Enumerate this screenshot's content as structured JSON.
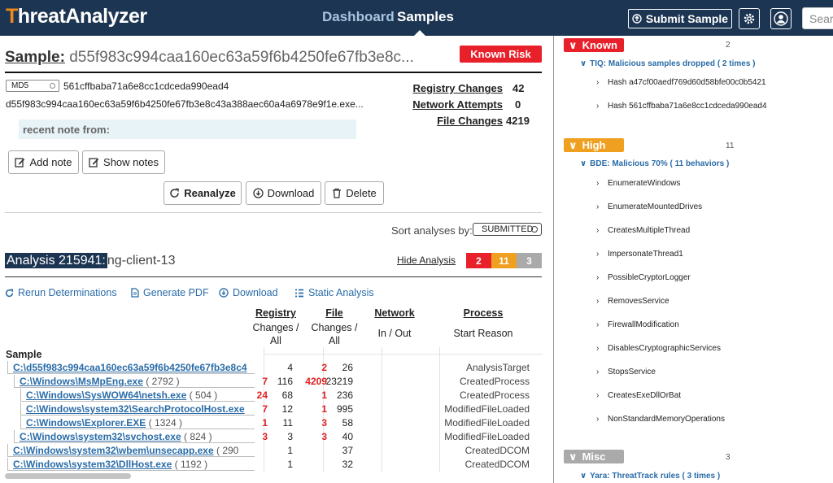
{
  "nav": {
    "logo_main": "ThreatAnalyzer",
    "links": [
      "Dashboard",
      "Samples"
    ],
    "submit_label": "Submit Sample",
    "search_placeholder": "Search"
  },
  "sample": {
    "title_label": "Sample:",
    "title_hash": "d55f983c994caa160ec63a59f6b4250fe67fb3e8c...",
    "risk_badge": "Known Risk",
    "hash_type": "MD5",
    "md5": "561cffbaba71a6e8cc1cdceda990ead4",
    "sha": "d55f983c994caa160ec63a59f6b4250fe67fb3e8c43a388aec60a4a6978e9f1e.exe...",
    "stats": [
      {
        "label": "Registry Changes",
        "value": "42"
      },
      {
        "label": "Network Attempts",
        "value": "0"
      },
      {
        "label": "File Changes",
        "value": "4219"
      }
    ],
    "note": "recent note from:",
    "buttons": {
      "add_note": "Add note",
      "show_notes": "Show notes",
      "reanalyze": "Reanalyze",
      "download": "Download",
      "delete": "Delete"
    },
    "sort_label": "Sort analyses by:",
    "sort_value": "SUBMITTED"
  },
  "analysis": {
    "title_hl": "Analysis 215941:",
    "title_rest": "ng-client-13",
    "hide_label": "Hide Analysis",
    "counts": [
      "2",
      "11",
      "3"
    ],
    "toolbar": [
      "Rerun Determinations",
      "Generate PDF",
      "Download",
      "Static Analysis"
    ],
    "headers": {
      "registry": "Registry",
      "registry_sub": "Changes /",
      "registry_sub2": "All",
      "file": "File",
      "file_sub": "Changes /",
      "file_sub2": "All",
      "network": "Network",
      "network_sub": "In / Out",
      "process": "Process",
      "process_sub": "Start Reason",
      "sample": "Sample"
    },
    "rows": [
      {
        "path": "C:\\d55f983c994caa160ec63a59f6b4250fe67fb3e8c4",
        "pid": "",
        "reg_c": "",
        "reg_a": "4",
        "file_c": "2",
        "file_a": "26",
        "reason": "AnalysisTarget"
      },
      {
        "path": "C:\\Windows\\MsMpEng.exe",
        "pid": "( 2792 )",
        "reg_c": "7",
        "reg_a": "116",
        "file_c": "4209",
        "file_a": "23219",
        "reason": "CreatedProcess"
      },
      {
        "path": "C:\\Windows\\SysWOW64\\netsh.exe",
        "pid": "( 504 )",
        "reg_c": "24",
        "reg_a": "68",
        "file_c": "1",
        "file_a": "236",
        "reason": "CreatedProcess"
      },
      {
        "path": "C:\\Windows\\system32\\SearchProtocolHost.exe",
        "pid": "",
        "reg_c": "7",
        "reg_a": "12",
        "file_c": "1",
        "file_a": "995",
        "reason": "ModifiedFileLoaded"
      },
      {
        "path": "C:\\Windows\\Explorer.EXE",
        "pid": "( 1324 )",
        "reg_c": "1",
        "reg_a": "11",
        "file_c": "3",
        "file_a": "58",
        "reason": "ModifiedFileLoaded"
      },
      {
        "path": "C:\\Windows\\system32\\svchost.exe",
        "pid": "( 824 )",
        "reg_c": "3",
        "reg_a": "3",
        "file_c": "3",
        "file_a": "40",
        "reason": "ModifiedFileLoaded"
      },
      {
        "path": "C:\\Windows\\system32\\wbem\\unsecapp.exe",
        "pid": "( 290",
        "reg_c": "",
        "reg_a": "1",
        "file_c": "",
        "file_a": "37",
        "reason": "CreatedDCOM"
      },
      {
        "path": "C:\\Windows\\system32\\DllHost.exe",
        "pid": "( 1192 )",
        "reg_c": "",
        "reg_a": "1",
        "file_c": "",
        "file_a": "32",
        "reason": "CreatedDCOM"
      }
    ]
  },
  "findings": {
    "known": {
      "label": "Known",
      "count": "2",
      "group": "TIQ: Malicious samples dropped ( 2 times )",
      "items": [
        "Hash a47cf00aedf769d60d58bfe00c0b5421",
        "Hash 561cffbaba71a6e8cc1cdceda990ead4"
      ]
    },
    "high": {
      "label": "High",
      "count": "11",
      "group": "BDE: Malicious 70% ( 11 behaviors )",
      "items": [
        "EnumerateWindows",
        "EnumerateMountedDrives",
        "CreatesMultipleThread",
        "ImpersonateThread1",
        "PossibleCryptorLogger",
        "RemovesService",
        "FirewallModification",
        "DisablesCryptographicServices",
        "StopsService",
        "CreatesExeDllOrBat",
        "NonStandardMemoryOperations"
      ]
    },
    "misc": {
      "label": "Misc",
      "count": "3",
      "group": "Yara: ThreatTrack rules ( 3 times )"
    }
  },
  "colors": {
    "nav": "#1c3552",
    "known": "#e8202a",
    "high": "#f0a020",
    "misc": "#aaaaaa",
    "link": "#2a6ca8"
  }
}
